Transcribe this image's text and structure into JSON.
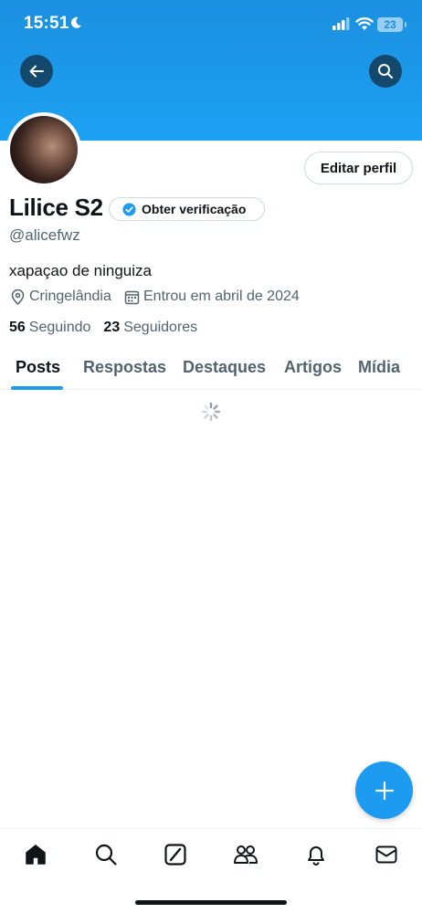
{
  "status_bar": {
    "time": "15:51",
    "battery": "23"
  },
  "profile": {
    "name": "Lilice S2",
    "handle": "@alicefwz",
    "bio": "xapaçao de ninguiza",
    "location": "Cringelândia",
    "joined": "Entrou em abril de 2024",
    "following_count": "56",
    "following_label": "Seguindo",
    "followers_count": "23",
    "followers_label": "Seguidores"
  },
  "actions": {
    "edit_profile": "Editar perfil",
    "verify": "Obter verificação"
  },
  "tabs": [
    {
      "label": "Posts",
      "active": true
    },
    {
      "label": "Respostas"
    },
    {
      "label": "Destaques"
    },
    {
      "label": "Artigos"
    },
    {
      "label": "Mídia"
    }
  ],
  "bottom_nav": [
    "home-icon",
    "search-icon",
    "grok-icon",
    "communities-icon",
    "notifications-icon",
    "messages-icon"
  ],
  "colors": {
    "accent": "#1d9bf0",
    "banner": "#1c8fe0",
    "text": "#0f1419",
    "secondary": "#536471"
  }
}
